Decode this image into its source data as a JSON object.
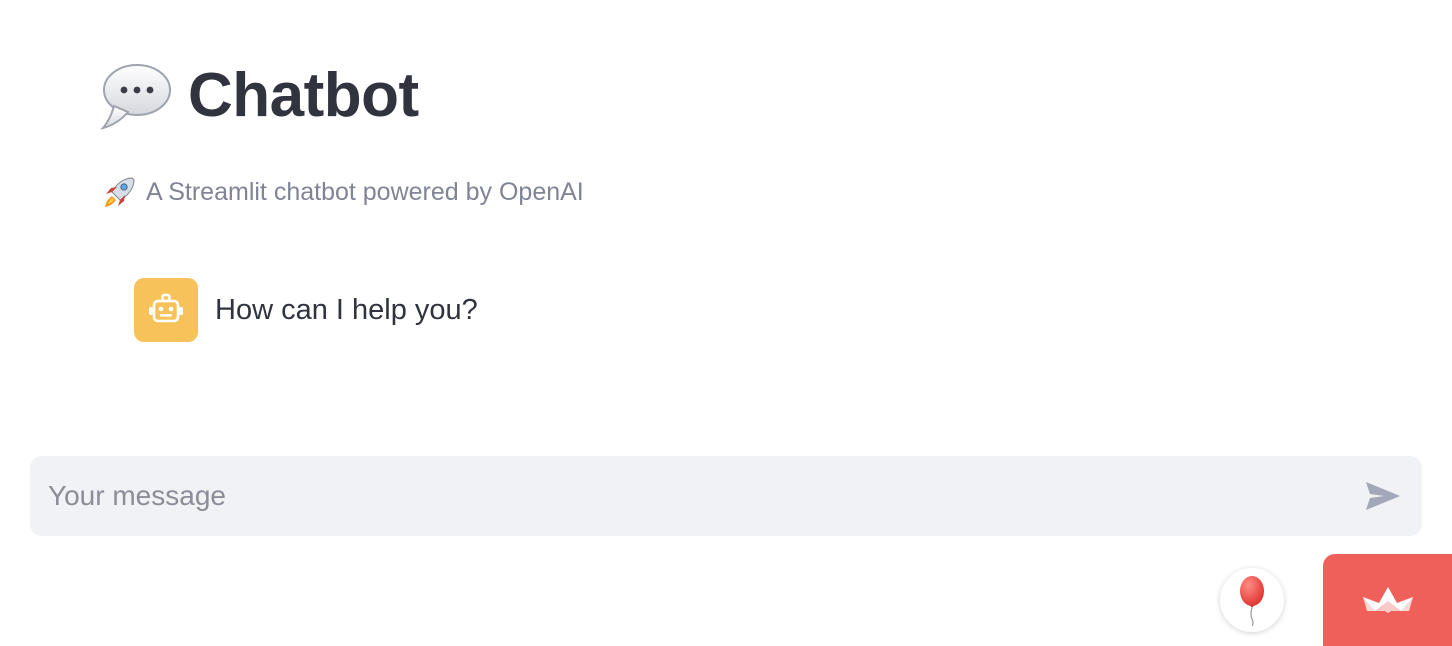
{
  "header": {
    "title": "Chatbot",
    "title_icon": "speech-bubble-icon",
    "caption": "A Streamlit chatbot powered by OpenAI",
    "caption_icon": "rocket-icon"
  },
  "chat": {
    "messages": [
      {
        "role": "assistant",
        "avatar_icon": "robot-icon",
        "text": "How can I help you?"
      }
    ]
  },
  "input": {
    "placeholder": "Your message",
    "value": "",
    "send_icon": "send-icon"
  },
  "footer": {
    "balloon_icon": "balloon-icon",
    "badge_icon": "streamlit-crown-icon"
  },
  "colors": {
    "title_text": "#31333f",
    "caption_text": "#808495",
    "avatar_bg": "#f7c25a",
    "input_bg": "#f0f2f6",
    "placeholder_text": "#8b8d98",
    "send_icon": "#a3a8b8",
    "badge_bg": "#f0605b"
  }
}
